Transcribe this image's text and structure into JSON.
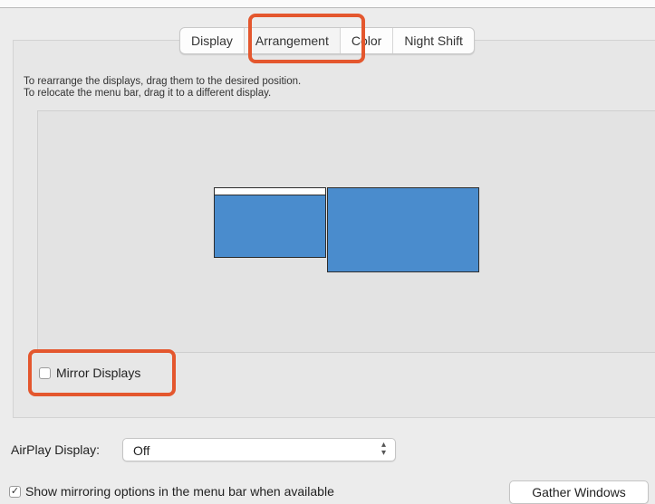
{
  "tabs": [
    {
      "label": "Display"
    },
    {
      "label": "Arrangement"
    },
    {
      "label": "Color"
    },
    {
      "label": "Night Shift"
    }
  ],
  "instructions": {
    "line1": "To rearrange the displays, drag them to the desired position.",
    "line2": "To relocate the menu bar, drag it to a different display."
  },
  "mirror": {
    "label": "Mirror Displays",
    "checked": false
  },
  "airplay": {
    "label": "AirPlay Display:",
    "value": "Off"
  },
  "show_mirroring": {
    "label": "Show mirroring options in the menu bar when available",
    "checked": true,
    "check_glyph": "✓"
  },
  "gather": {
    "label": "Gather Windows"
  },
  "colors": {
    "display_fill": "#4a8ccd",
    "highlight": "#e4572e"
  }
}
